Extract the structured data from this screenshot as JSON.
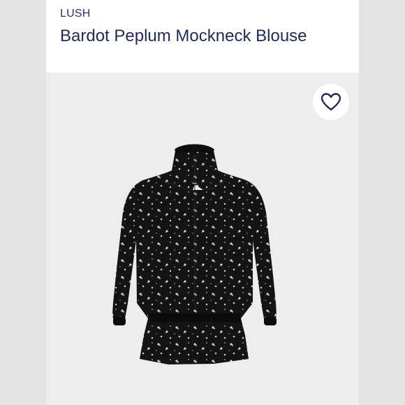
{
  "product": {
    "brand": "LUSH",
    "title": "Bardot Peplum Mockneck Blouse"
  },
  "actions": {
    "favorite_icon": "heart-outline-icon"
  },
  "colors": {
    "brand_text": "#23327a",
    "title_text": "#1f2a5c",
    "photo_background": "#ededee",
    "garment": "#141414"
  }
}
